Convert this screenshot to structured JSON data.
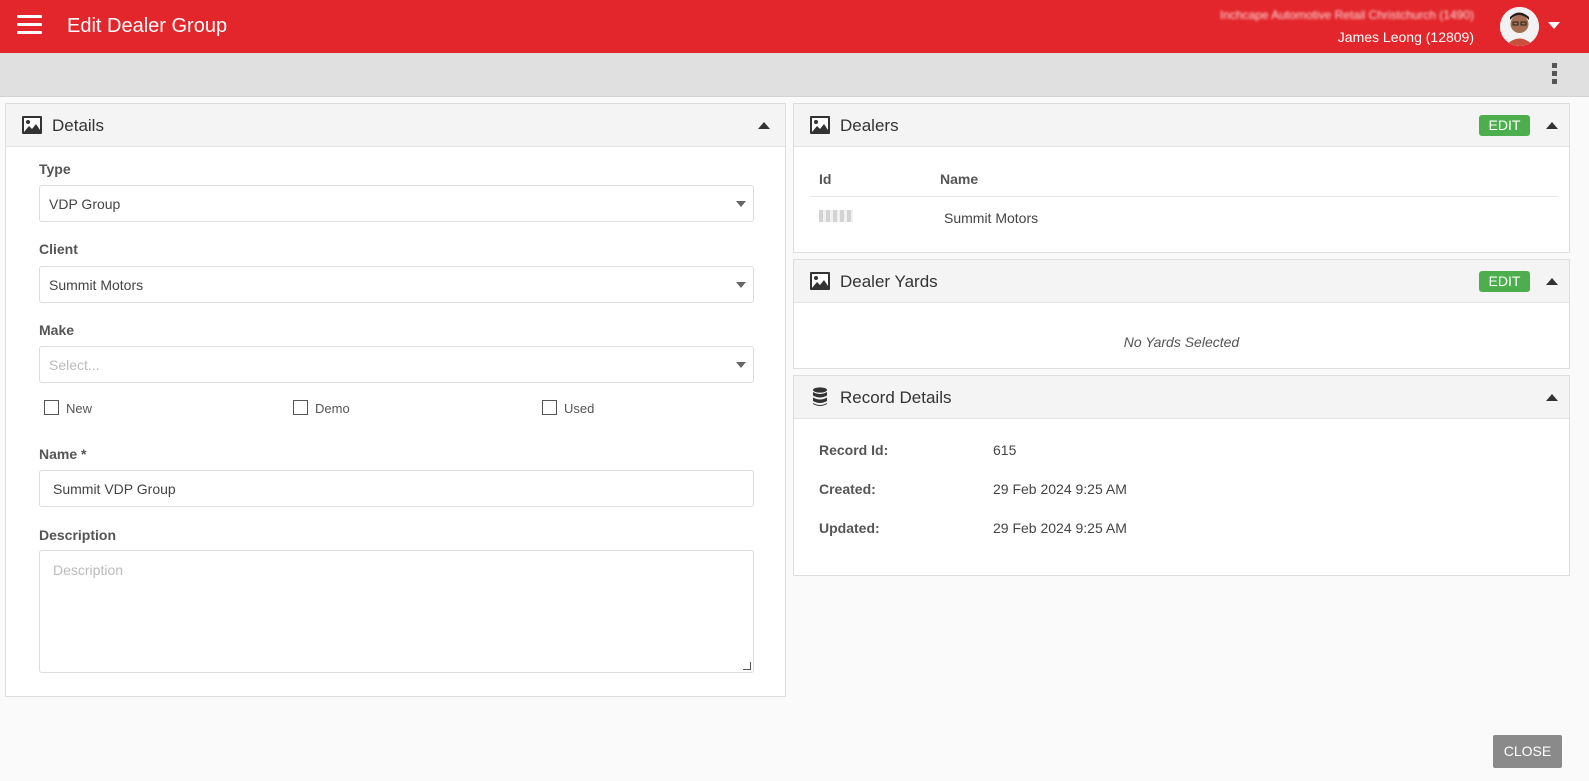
{
  "header": {
    "title": "Edit Dealer Group",
    "org_line": "Inchcape Automotive Retail Christchurch (1490)",
    "user_name": "James Leong (12809)",
    "accent_color": "#e3262b"
  },
  "details": {
    "title": "Details",
    "type": {
      "label": "Type",
      "value": "VDP Group"
    },
    "client": {
      "label": "Client",
      "value": "Summit Motors"
    },
    "make": {
      "label": "Make",
      "placeholder": "Select..."
    },
    "checkboxes": [
      {
        "label": "New",
        "checked": false
      },
      {
        "label": "Demo",
        "checked": false
      },
      {
        "label": "Used",
        "checked": false
      }
    ],
    "name": {
      "label": "Name *",
      "value": "Summit VDP Group"
    },
    "description": {
      "label": "Description",
      "placeholder": "Description"
    }
  },
  "dealers": {
    "title": "Dealers",
    "edit_label": "EDIT",
    "columns": [
      "Id",
      "Name"
    ],
    "rows": [
      {
        "name": "Summit Motors"
      }
    ]
  },
  "dealer_yards": {
    "title": "Dealer Yards",
    "edit_label": "EDIT",
    "empty_message": "No Yards Selected"
  },
  "record_details": {
    "title": "Record Details",
    "fields": [
      {
        "label": "Record Id:",
        "value": "615"
      },
      {
        "label": "Created:",
        "value": "29 Feb 2024 9:25 AM"
      },
      {
        "label": "Updated:",
        "value": "29 Feb 2024 9:25 AM"
      }
    ]
  },
  "footer": {
    "close_label": "CLOSE"
  },
  "icons": {
    "menu": "hamburger-icon",
    "panel": "image-icon",
    "record": "database-icon",
    "more": "kebab-icon"
  }
}
